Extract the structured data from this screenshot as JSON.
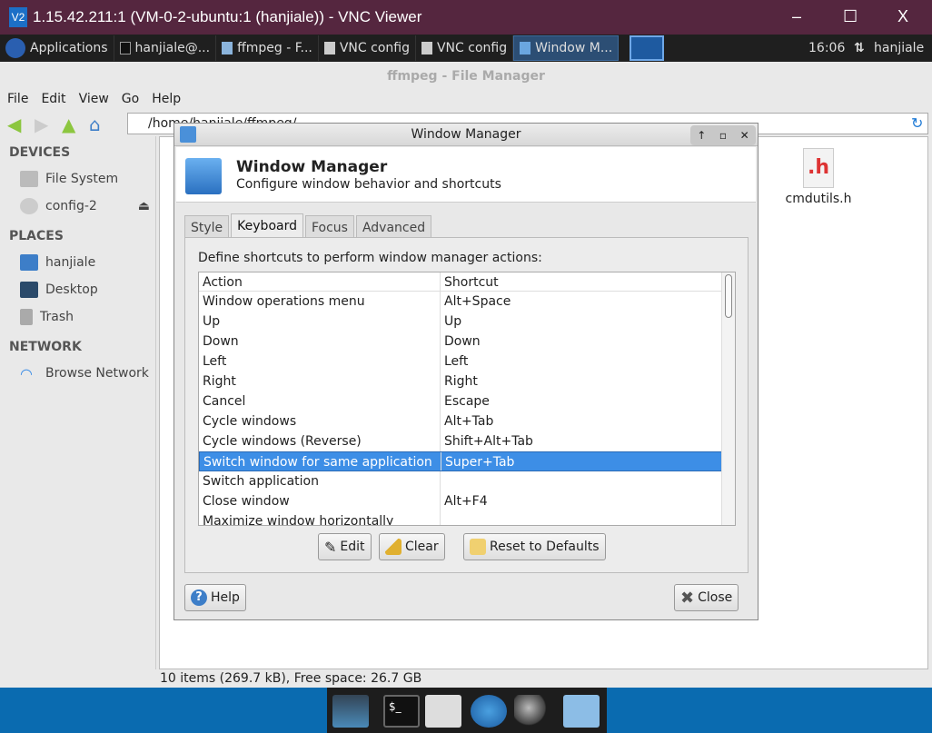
{
  "vnc": {
    "title": "1.15.42.211:1 (VM-0-2-ubuntu:1 (hanjiale)) - VNC Viewer",
    "logo": "V2",
    "minimize": "–",
    "maximize": "☐",
    "close": "X"
  },
  "panel": {
    "apps": "Applications",
    "tasks": [
      "hanjiale@...",
      "ffmpeg - F...",
      "VNC config",
      "VNC config",
      "Window M..."
    ],
    "clock": "16:06",
    "user": "hanjiale"
  },
  "fm": {
    "title": "ffmpeg - File Manager",
    "menu": [
      "File",
      "Edit",
      "View",
      "Go",
      "Help"
    ],
    "address": "/home/hanjiale/ffmpeg/",
    "sidebar": {
      "devices": "DEVICES",
      "device_items": [
        "File System",
        "config-2"
      ],
      "places": "PLACES",
      "place_items": [
        "hanjiale",
        "Desktop",
        "Trash"
      ],
      "network": "NETWORK",
      "network_items": [
        "Browse Network"
      ]
    },
    "file": {
      "name": "cmdutils.h",
      "icon_label": ".h"
    },
    "status": "10 items (269.7 kB), Free space: 26.7 GB"
  },
  "dialog": {
    "title": "Window Manager",
    "heading": "Window Manager",
    "subheading": "Configure window behavior and shortcuts",
    "tabs": [
      "Style",
      "Keyboard",
      "Focus",
      "Advanced"
    ],
    "active_tab": "Keyboard",
    "description": "Define shortcuts to perform window manager actions:",
    "columns": [
      "Action",
      "Shortcut"
    ],
    "rows": [
      [
        "Window operations menu",
        "Alt+Space"
      ],
      [
        "Up",
        "Up"
      ],
      [
        "Down",
        "Down"
      ],
      [
        "Left",
        "Left"
      ],
      [
        "Right",
        "Right"
      ],
      [
        "Cancel",
        "Escape"
      ],
      [
        "Cycle windows",
        "Alt+Tab"
      ],
      [
        "Cycle windows (Reverse)",
        "Shift+Alt+Tab"
      ],
      [
        "Switch window for same application",
        "Super+Tab"
      ],
      [
        "Switch application",
        ""
      ],
      [
        "Close window",
        "Alt+F4"
      ],
      [
        "Maximize window horizontally",
        ""
      ]
    ],
    "selected_row": 8,
    "buttons": {
      "edit": "Edit",
      "clear": "Clear",
      "reset": "Reset to Defaults",
      "help": "Help",
      "close": "Close"
    }
  },
  "colors": {
    "vnc_title": "#55263f",
    "selection": "#3d8ee6",
    "desktop": "#0a6bb0"
  }
}
